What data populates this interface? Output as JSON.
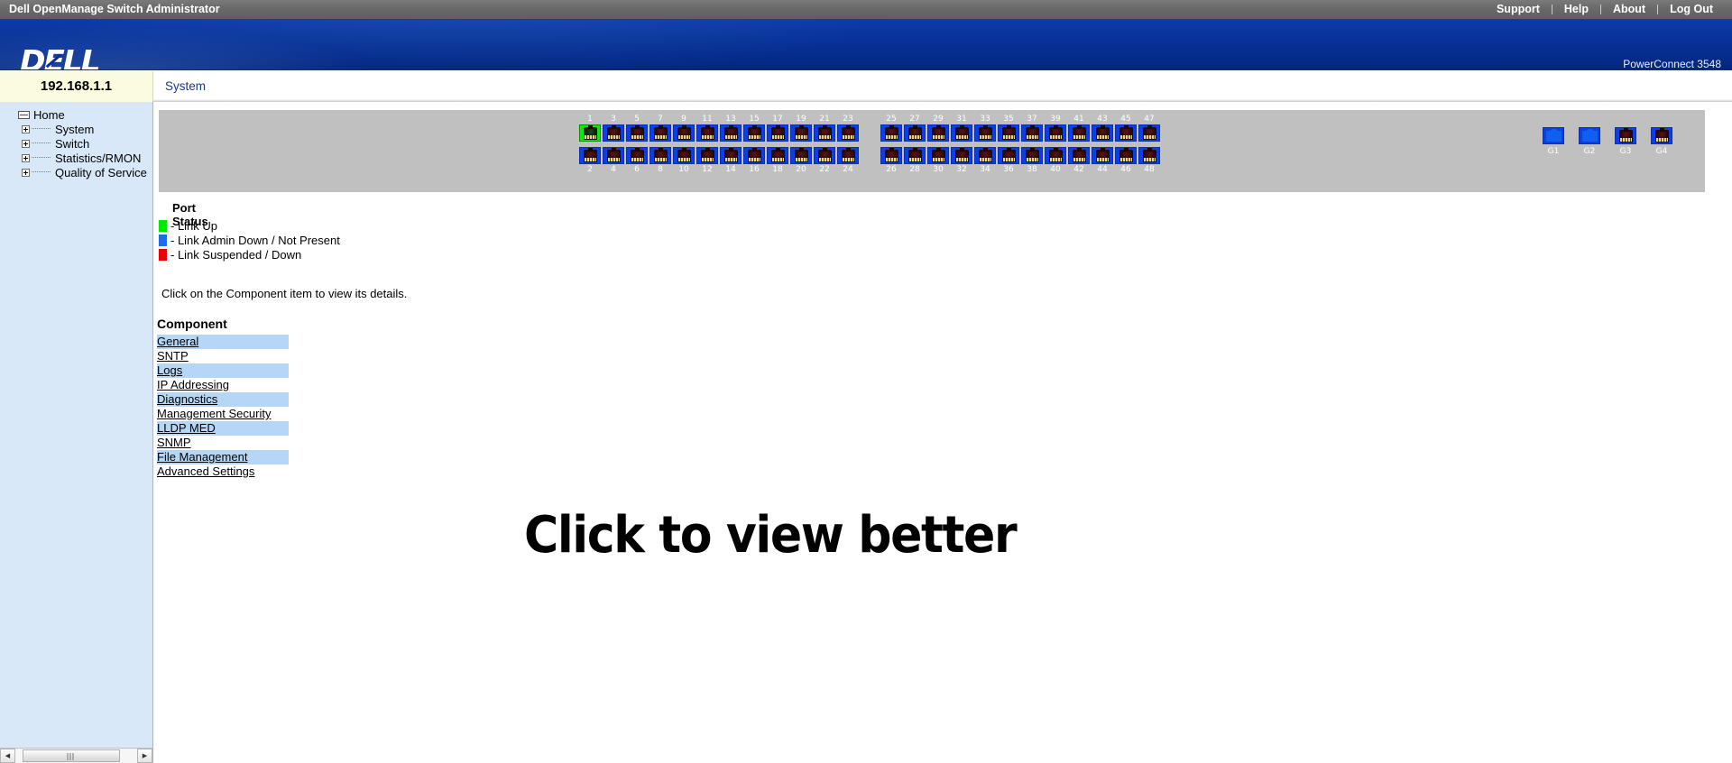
{
  "titlebar": {
    "app_title": "Dell OpenManage Switch Administrator",
    "links": [
      "Support",
      "Help",
      "About",
      "Log Out"
    ]
  },
  "brand": {
    "logo_text": "DELL",
    "model": "PowerConnect 3548"
  },
  "device": {
    "ip_address": "192.168.1.1"
  },
  "tabs": [
    {
      "label": "System",
      "active": true
    }
  ],
  "sidebar": {
    "root": {
      "label": "Home",
      "icon": "page-icon"
    },
    "items": [
      {
        "label": "System",
        "icon": "plus-expander-icon"
      },
      {
        "label": "Switch",
        "icon": "plus-expander-icon"
      },
      {
        "label": "Statistics/RMON",
        "icon": "plus-expander-icon"
      },
      {
        "label": "Quality of Service",
        "icon": "plus-expander-icon"
      }
    ],
    "scrollbar": {
      "left_arrow": "◀",
      "right_arrow": "▶"
    }
  },
  "panel": {
    "rj45_groups": [
      {
        "top_labels": [
          "1",
          "3",
          "5",
          "7",
          "9",
          "11"
        ],
        "bottom_labels": [
          "2",
          "4",
          "6",
          "8",
          "10",
          "12"
        ]
      },
      {
        "top_labels": [
          "13",
          "15",
          "17",
          "19",
          "21",
          "23"
        ],
        "bottom_labels": [
          "14",
          "16",
          "18",
          "20",
          "22",
          "24"
        ]
      },
      {
        "top_labels": [
          "25",
          "27",
          "29",
          "31",
          "33",
          "35"
        ],
        "bottom_labels": [
          "26",
          "28",
          "30",
          "32",
          "34",
          "36"
        ]
      },
      {
        "top_labels": [
          "37",
          "39",
          "41",
          "43",
          "45",
          "47"
        ],
        "bottom_labels": [
          "38",
          "40",
          "42",
          "44",
          "46",
          "48"
        ]
      }
    ],
    "link_up_ports": [
      "1"
    ],
    "uplinks": [
      {
        "label": "G1",
        "type": "sfp"
      },
      {
        "label": "G2",
        "type": "sfp"
      },
      {
        "label": "G3",
        "type": "rj45"
      },
      {
        "label": "G4",
        "type": "rj45"
      }
    ]
  },
  "legend": {
    "title": "Port Status",
    "entries": [
      {
        "color": "#00e800",
        "text": "- Link Up"
      },
      {
        "color": "#1c6ee8",
        "text": "- Link Admin Down / Not Present"
      },
      {
        "color": "#ee0000",
        "text": "- Link Suspended / Down"
      }
    ]
  },
  "main": {
    "hint": "Click on the Component item to view its details.",
    "component_heading": "Component",
    "components": [
      "General",
      "SNTP",
      "Logs",
      "IP Addressing",
      "Diagnostics",
      "Management Security",
      "LLDP MED",
      "SNMP",
      "File Management",
      "Advanced Settings"
    ],
    "overlay_text": "Click to view better"
  }
}
